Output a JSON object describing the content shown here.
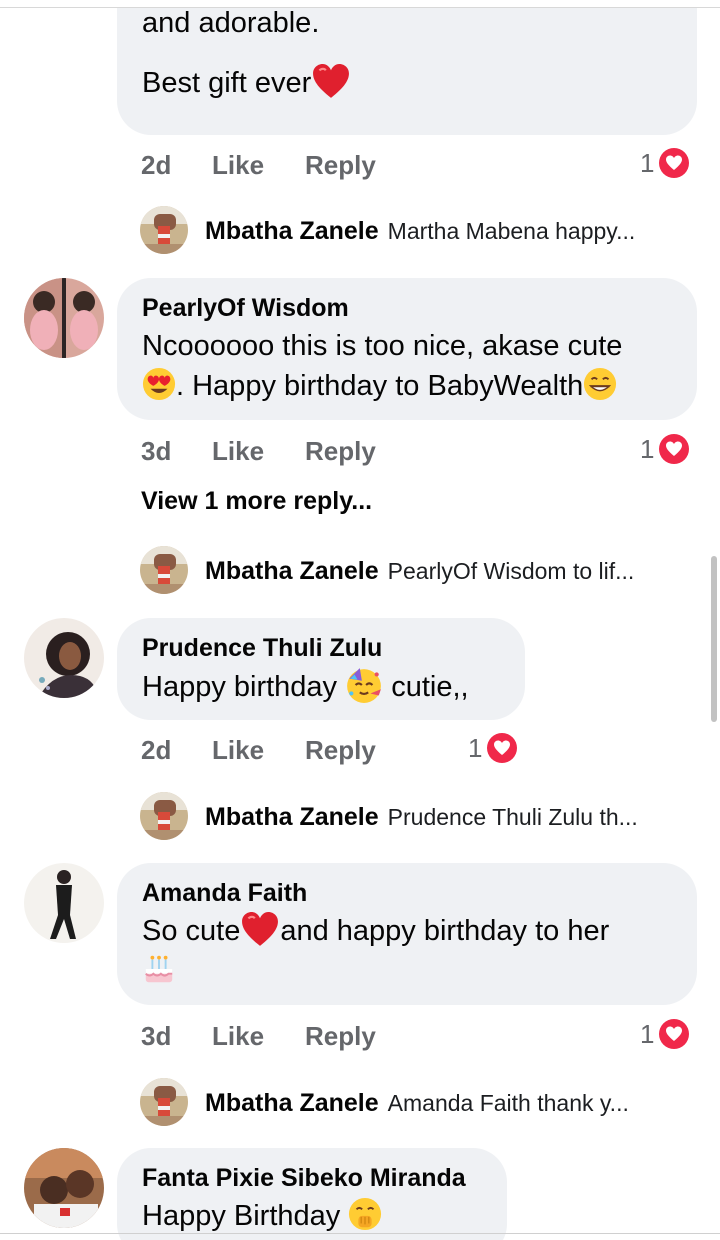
{
  "comments": [
    {
      "author": "",
      "lines": [
        "and adorable.",
        "",
        "Best gift ever"
      ],
      "time": "2d",
      "like": "Like",
      "reply": "Reply",
      "reactions": "1",
      "reply_preview": {
        "name": "Mbatha Zanele",
        "text": "Martha Mabena happy..."
      }
    },
    {
      "author": "PearlyOf Wisdom",
      "lines": [
        "Ncoooooo this is too nice, akase cute",
        ". Happy birthday to BabyWealth"
      ],
      "time": "3d",
      "like": "Like",
      "reply": "Reply",
      "reactions": "1",
      "more_replies": "View 1 more reply...",
      "reply_preview": {
        "name": "Mbatha Zanele",
        "text": "PearlyOf Wisdom to lif..."
      }
    },
    {
      "author": "Prudence Thuli Zulu",
      "lines": [
        "Happy birthday",
        "cutie,,"
      ],
      "time": "2d",
      "like": "Like",
      "reply": "Reply",
      "reactions": "1",
      "reply_preview": {
        "name": "Mbatha Zanele",
        "text": "Prudence Thuli Zulu th..."
      }
    },
    {
      "author": "Amanda Faith",
      "lines": [
        "So cute",
        "and happy birthday to her"
      ],
      "time": "3d",
      "like": "Like",
      "reply": "Reply",
      "reactions": "1",
      "reply_preview": {
        "name": "Mbatha Zanele",
        "text": "Amanda Faith thank y..."
      }
    },
    {
      "author": "Fanta Pixie Sibeko Miranda",
      "lines": [
        "Happy Birthday"
      ]
    }
  ],
  "colors": {
    "bubble": "#eff1f4",
    "meta_text": "#65676b",
    "heart": "#f0284a"
  }
}
